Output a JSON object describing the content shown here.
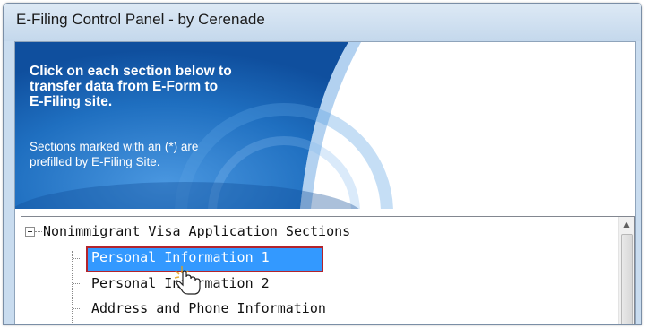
{
  "window": {
    "title": "E-Filing Control Panel - by Cerenade"
  },
  "banner": {
    "heading": "Click on each section below to\ntransfer data from E-Form to\nE-Filing site.",
    "note": "Sections marked with an (*) are\nprefilled by E-Filing Site."
  },
  "tree": {
    "root_label": "Nonimmigrant Visa Application Sections",
    "items": [
      {
        "label": "Personal Information 1",
        "selected": true
      },
      {
        "label": "Personal Information 2",
        "selected": false
      },
      {
        "label": "Address and Phone Information",
        "selected": false
      }
    ]
  },
  "colors": {
    "banner_blue": "#1d6fc2",
    "selection_fill": "#3399ff",
    "selection_border": "#b3242c",
    "titlebar": "#c9dcef"
  },
  "icons": {
    "expander": "minus-box-icon",
    "cursor": "hand-pointer-icon",
    "scroll_up": "up-arrow-icon"
  }
}
